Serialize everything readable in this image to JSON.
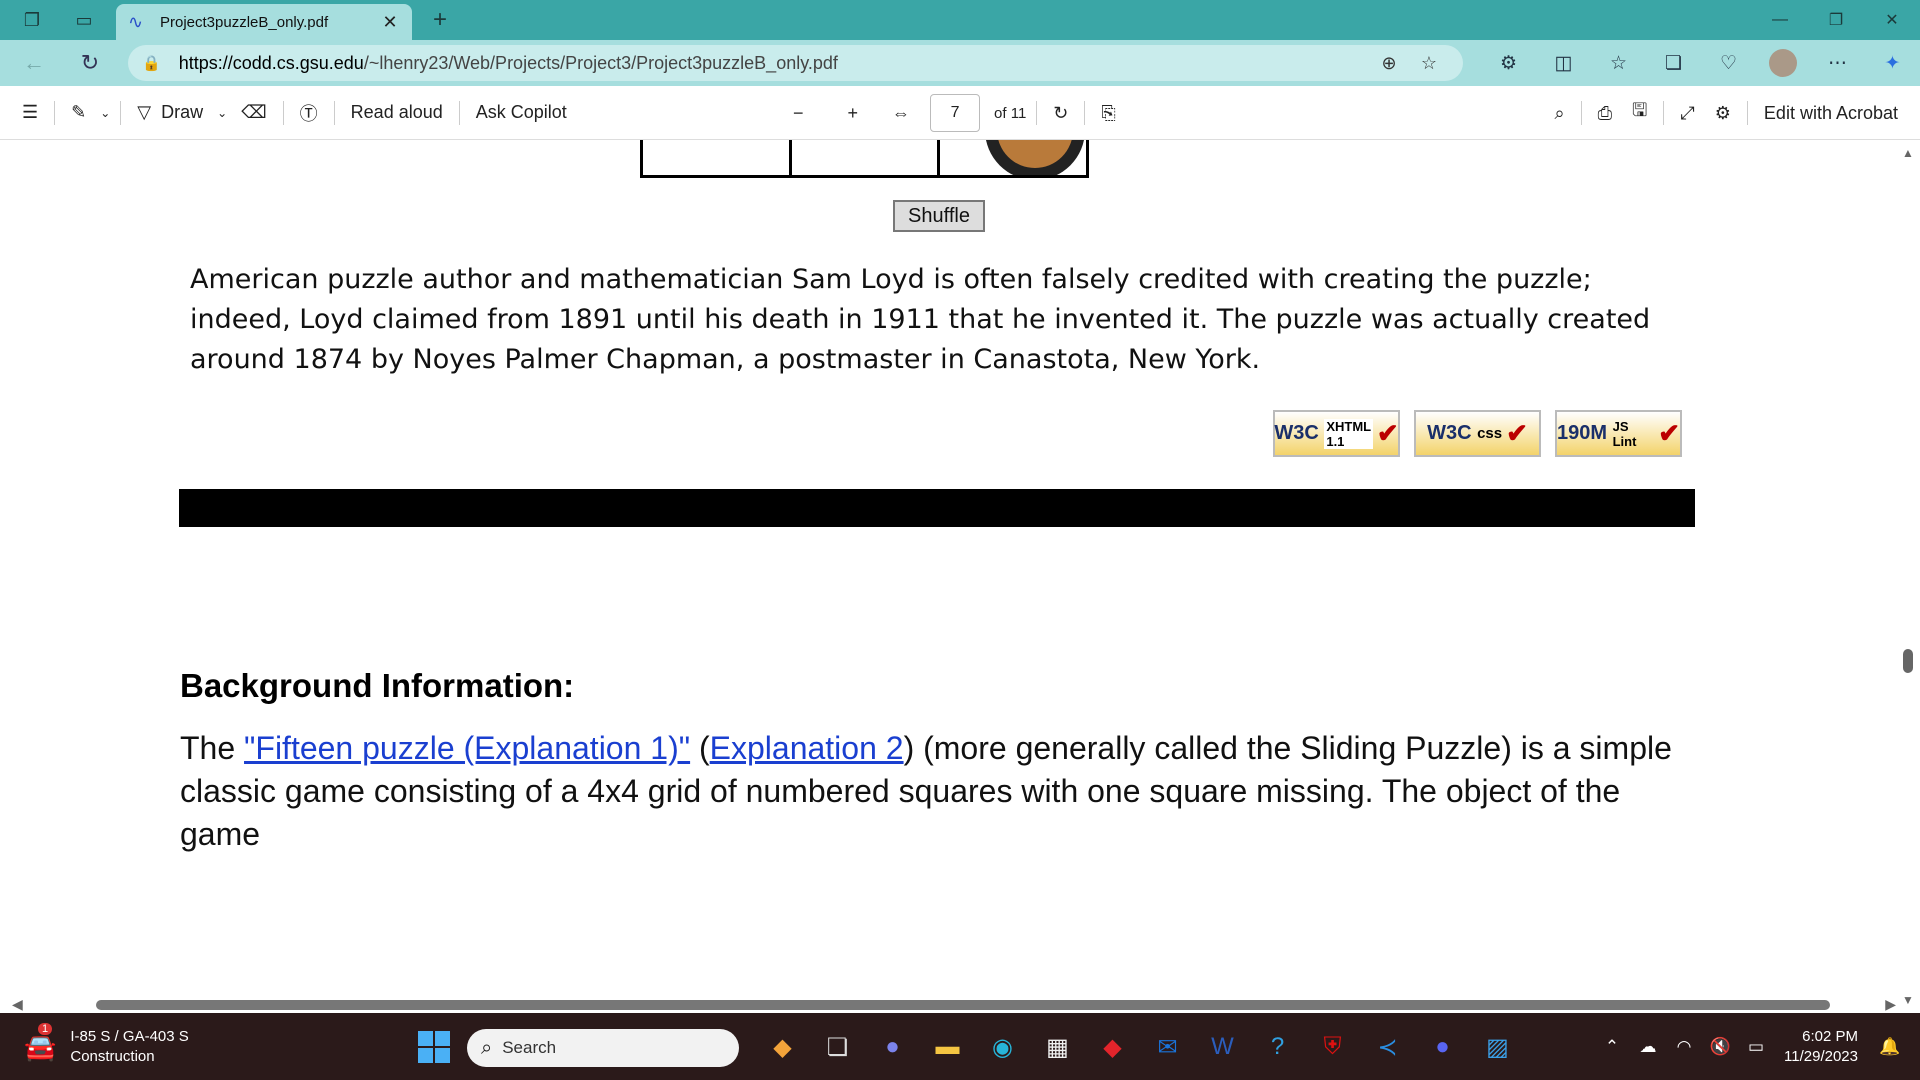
{
  "browser": {
    "tab_title": "Project3puzzleB_only.pdf",
    "url_host": "https://codd.cs.gsu.edu",
    "url_path": "/~lhenry23/Web/Projects/Project3/Project3puzzleB_only.pdf"
  },
  "pdf_toolbar": {
    "draw_label": "Draw",
    "read_aloud_label": "Read aloud",
    "ask_copilot_label": "Ask Copilot",
    "page_current": "7",
    "page_total": "of 11",
    "edit_acrobat_label": "Edit with Acrobat"
  },
  "document": {
    "shuffle_label": "Shuffle",
    "loyd_paragraph": "American puzzle author and mathematician Sam Loyd is often falsely credited with creating the puzzle; indeed, Loyd claimed from 1891 until his death in 1911 that he invented it. The puzzle was actually created around 1874 by Noyes Palmer Chapman, a postmaster in Canastota, New York.",
    "badges": [
      {
        "left": "W3C",
        "right": "XHTML 1.1"
      },
      {
        "left": "W3C",
        "right": "css"
      },
      {
        "left": "190M",
        "right": "JS Lint"
      }
    ],
    "bg_heading": "Background Information:",
    "bg_p_the": "The ",
    "bg_link1": "\"Fifteen puzzle (Explanation 1)\"",
    "bg_p_open": " (",
    "bg_link2": "Explanation 2",
    "bg_p_rest": ") (more generally called the Sliding Puzzle) is a simple classic game consisting of a 4x4 grid of numbered squares with one square missing. The object of the game"
  },
  "taskbar": {
    "weather_badge": "1",
    "weather_line1": "I-85 S / GA-403 S",
    "weather_line2": "Construction",
    "search_placeholder": "Search",
    "time": "6:02 PM",
    "date": "11/29/2023"
  },
  "colors": {
    "titlebar": "#3aa6a6",
    "addressbar": "#a6dede",
    "link": "#1a3fd0",
    "taskbar": "#2b1a1a"
  }
}
